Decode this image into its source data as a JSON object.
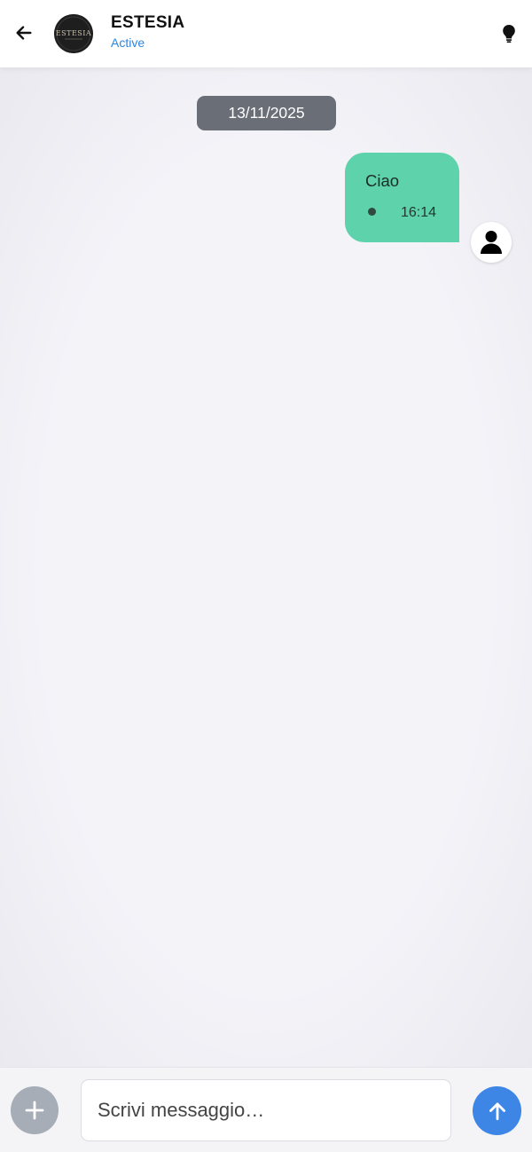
{
  "header": {
    "title": "ESTESIA",
    "status": "Active",
    "status_color": "#2e86de",
    "back_icon": "arrow-left-icon",
    "logo_text": "ESTESIA",
    "action_icon": "lightbulb-icon"
  },
  "chat": {
    "date_separator": "13/11/2025",
    "messages": [
      {
        "text": "Ciao",
        "time": "16:14",
        "direction": "outgoing",
        "bubble_color": "#5ed2aa"
      }
    ]
  },
  "composer": {
    "placeholder": "Scrivi messaggio…",
    "value": "",
    "attach_icon": "plus-icon",
    "send_icon": "arrow-up-icon",
    "send_color": "#3d86e6"
  }
}
